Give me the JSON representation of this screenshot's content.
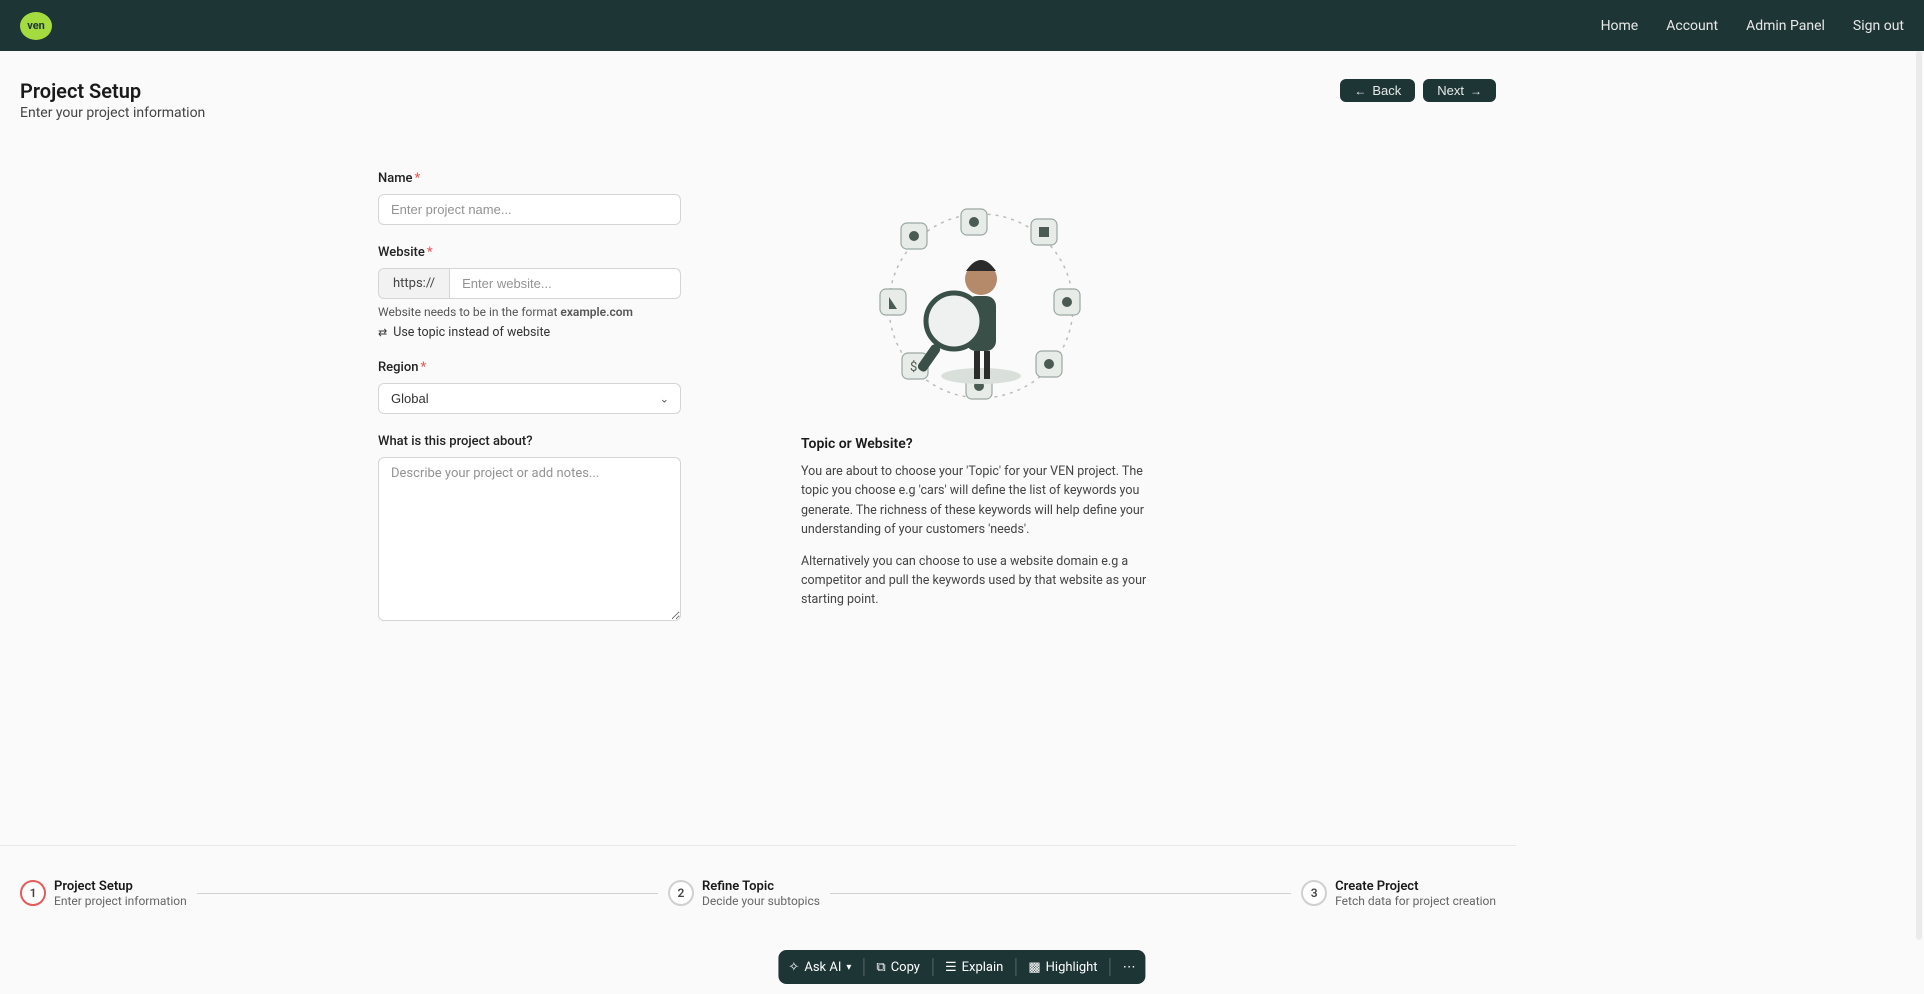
{
  "nav": {
    "logo_text": "ven",
    "links": [
      "Home",
      "Account",
      "Admin Panel",
      "Sign out"
    ]
  },
  "header": {
    "title": "Project Setup",
    "subtitle": "Enter your project information",
    "back_label": "Back",
    "next_label": "Next"
  },
  "form": {
    "name": {
      "label": "Name",
      "placeholder": "Enter project name..."
    },
    "website": {
      "label": "Website",
      "prefix": "https://",
      "placeholder": "Enter website...",
      "helper_pre": "Website needs to be in the format ",
      "helper_bold": "example.com",
      "switch_label": "Use topic instead of website"
    },
    "region": {
      "label": "Region",
      "value": "Global"
    },
    "about": {
      "label": "What is this project about?",
      "placeholder": "Describe your project or add notes..."
    }
  },
  "info": {
    "heading": "Topic or Website?",
    "para1": "You are about to choose your 'Topic' for your VEN project. The topic you choose e.g 'cars' will define the list of keywords you generate. The richness of these keywords will help define your understanding of your customers 'needs'.",
    "para2": "Alternatively you can choose to use a website domain e.g a competitor and pull the keywords used by that website as your starting point."
  },
  "stepper": {
    "steps": [
      {
        "num": "1",
        "title": "Project Setup",
        "sub": "Enter project information"
      },
      {
        "num": "2",
        "title": "Refine Topic",
        "sub": "Decide your subtopics"
      },
      {
        "num": "3",
        "title": "Create Project",
        "sub": "Fetch data for project creation"
      }
    ]
  },
  "selection_toolbar": {
    "ask": "Ask AI",
    "copy": "Copy",
    "explain": "Explain",
    "highlight": "Highlight"
  }
}
